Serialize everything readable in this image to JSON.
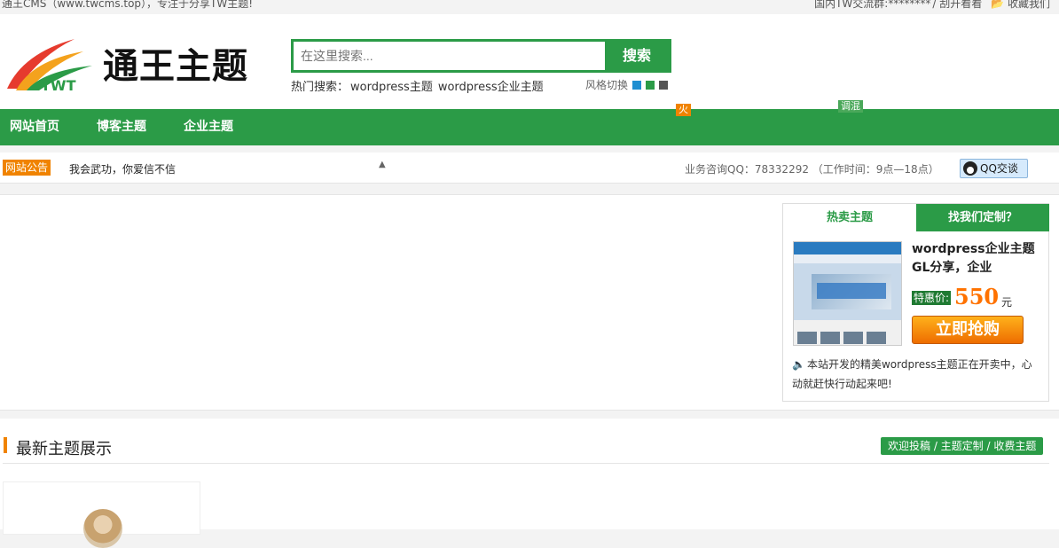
{
  "topbar": {
    "site_intro": "通王CMS（www.twcms.top），专注于分享TW主题!",
    "qq_group": "国内TW交流群:********",
    "open_eyes": "/ 刮开看看",
    "favorite": "收藏我们"
  },
  "header": {
    "logo_title": "通王主题",
    "search": {
      "placeholder": "在这里搜索...",
      "button": "搜索"
    },
    "hot_label": "热门搜索：",
    "hot_items": [
      "wordpress主题",
      "wordpress企业主题"
    ],
    "style_switch_label": "风格切换",
    "style_colors": [
      "#1f8fd1",
      "#2b9b47",
      "#555555"
    ]
  },
  "nav": {
    "items": [
      "网站首页",
      "博客主题",
      "企业主题"
    ],
    "badge_hot": "火",
    "badge_tune": "调混"
  },
  "notice": {
    "tag": "网站公告",
    "message": "我会武功，你爱信不信",
    "consult": "业务咨询QQ：78332292 （工作时间：9点—18点）",
    "qq_button": "QQ交谈"
  },
  "sidebar": {
    "tab_hot": "热卖主题",
    "tab_custom": "找我们定制？",
    "product_title": "wordpress企业主题GL分享，企业",
    "price_label": "特惠价:",
    "price": "550",
    "unit": "元",
    "buy_button": "立即抢购",
    "desc": "本站开发的精美wordpress主题正在开卖中，心动就赶快行动起来吧!"
  },
  "latest": {
    "heading": "最新主题展示",
    "contribute": "欢迎投稿 / 主题定制 / 收费主题"
  },
  "colors": {
    "brand_green": "#2b9b47",
    "accent_orange": "#f08300",
    "price_orange": "#ff7200"
  }
}
